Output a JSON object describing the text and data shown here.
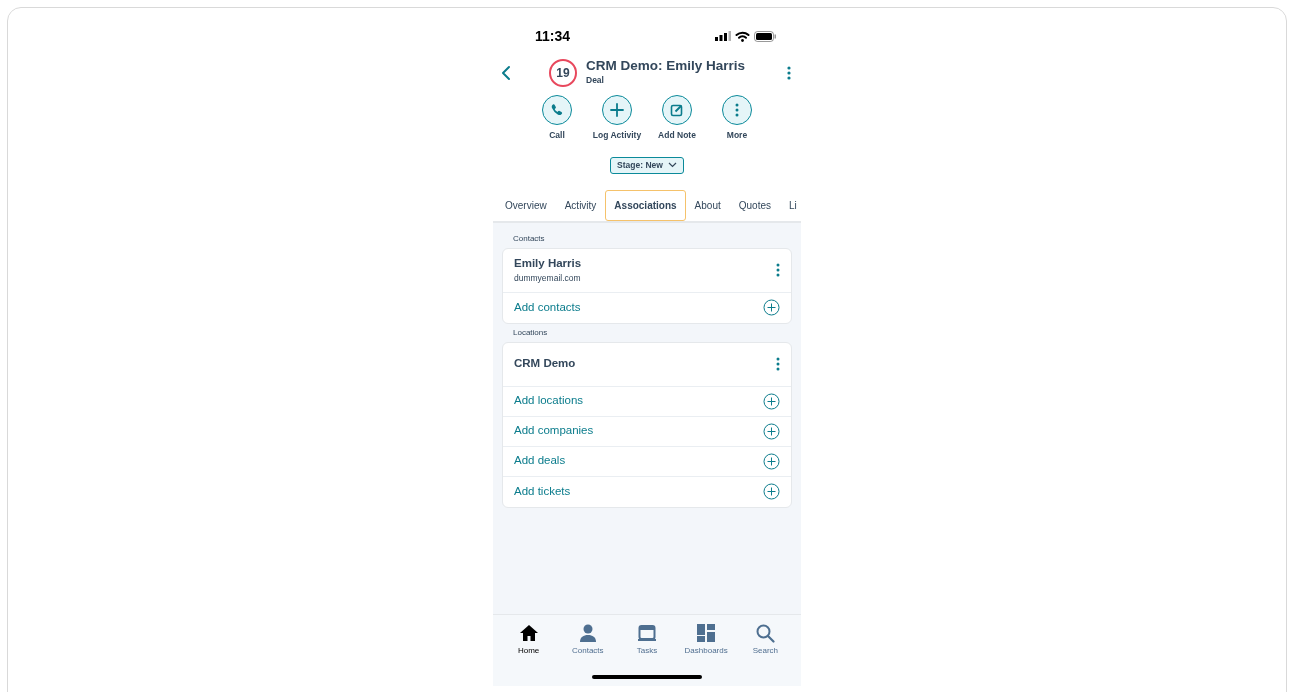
{
  "status_bar": {
    "time": "11:34"
  },
  "header": {
    "badge": "19",
    "title": "CRM Demo: Emily Harris",
    "subtitle": "Deal"
  },
  "actions": [
    {
      "kind": "call",
      "label": "Call"
    },
    {
      "kind": "log",
      "label": "Log Activity"
    },
    {
      "kind": "note",
      "label": "Add Note"
    },
    {
      "kind": "more",
      "label": "More"
    }
  ],
  "stage": {
    "label": "Stage: New"
  },
  "tabs": [
    {
      "label": "Overview",
      "selected": false
    },
    {
      "label": "Activity",
      "selected": false
    },
    {
      "label": "Associations",
      "selected": true
    },
    {
      "label": "About",
      "selected": false
    },
    {
      "label": "Quotes",
      "selected": false
    },
    {
      "label": "Li",
      "selected": false
    }
  ],
  "sections": [
    {
      "heading": "Contacts",
      "records": [
        {
          "name": "Emily Harris",
          "detail": "dummyemail.com"
        }
      ],
      "add_links": [
        "Add contacts"
      ]
    },
    {
      "heading": "Locations",
      "records": [
        {
          "name": "CRM Demo"
        }
      ],
      "add_links": [
        "Add locations",
        "Add companies",
        "Add deals",
        "Add tickets"
      ]
    }
  ],
  "bottom_nav": [
    {
      "kind": "home",
      "label": "Home",
      "selected": true
    },
    {
      "kind": "contacts",
      "label": "Contacts",
      "selected": false
    },
    {
      "kind": "tasks",
      "label": "Tasks",
      "selected": false
    },
    {
      "kind": "dashboards",
      "label": "Dashboards",
      "selected": false
    },
    {
      "kind": "search",
      "label": "Search",
      "selected": false
    }
  ]
}
